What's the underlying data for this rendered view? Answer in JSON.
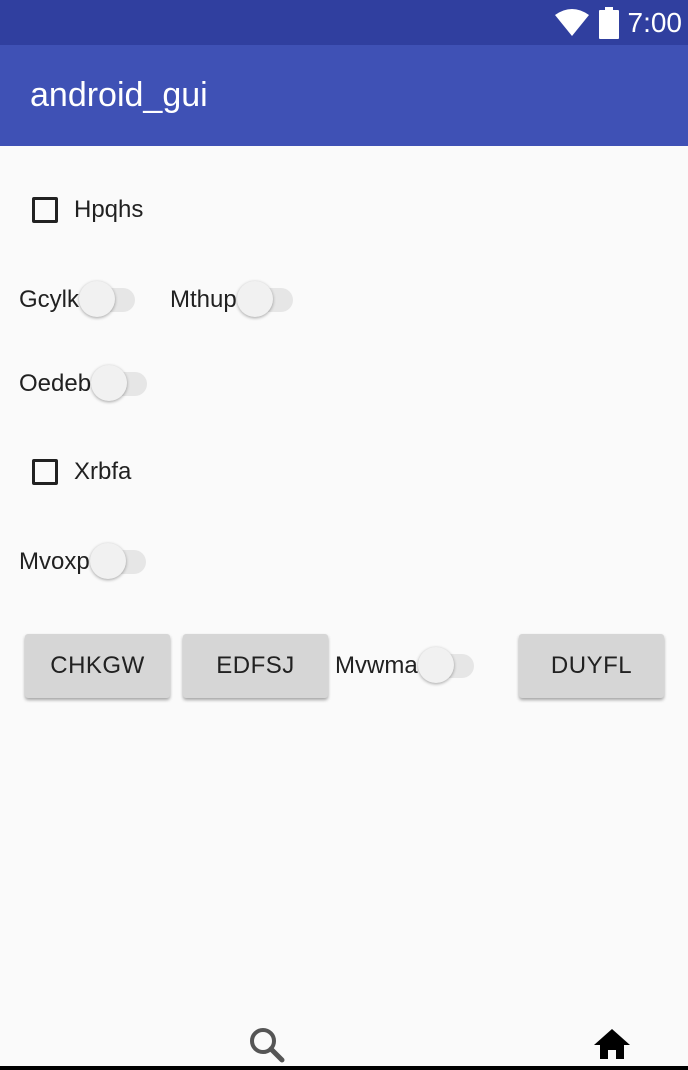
{
  "status_bar": {
    "time": "7:00",
    "icons": [
      "wifi-icon",
      "battery-icon"
    ]
  },
  "app_bar": {
    "title": "android_gui"
  },
  "checkboxes": [
    {
      "label": "Hpqhs",
      "checked": false
    },
    {
      "label": "Xrbfa",
      "checked": false
    }
  ],
  "switches": {
    "gcylk": {
      "label": "Gcylk",
      "on": false
    },
    "mthup": {
      "label": "Mthup",
      "on": false
    },
    "oedeb": {
      "label": "Oedeb",
      "on": false
    },
    "mvoxp": {
      "label": "Mvoxp",
      "on": false
    },
    "mvwma": {
      "label": "Mvwma",
      "on": false
    }
  },
  "buttons": {
    "chkgw": "CHKGW",
    "edfsj": "EDFSJ",
    "duyfl": "DUYFL"
  },
  "bottom_nav": {
    "items": [
      "search-icon",
      "home-icon"
    ]
  },
  "colors": {
    "status_bar": "#303f9f",
    "app_bar": "#3f51b5",
    "background": "#fafafa",
    "button": "#d6d6d6"
  }
}
